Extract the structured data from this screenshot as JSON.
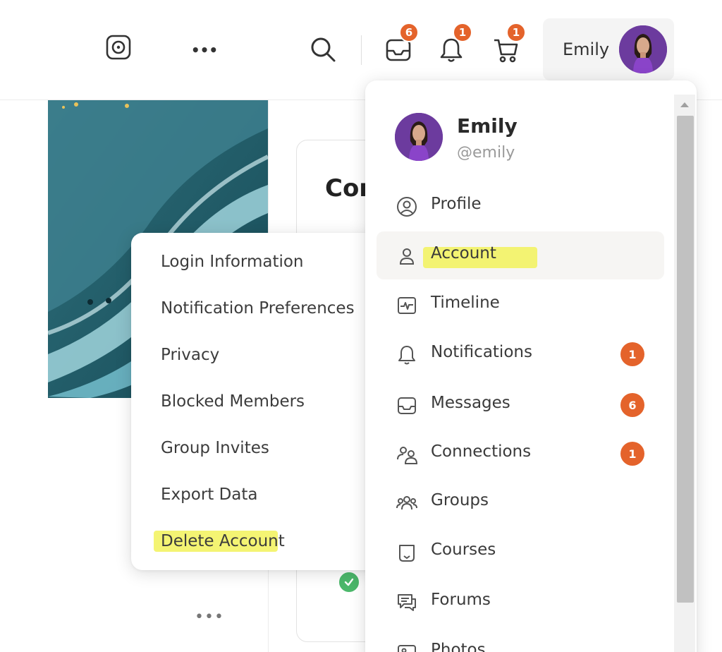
{
  "header": {
    "user_name": "Emily",
    "badges": {
      "messages": "6",
      "notifications": "1",
      "cart": "1"
    },
    "more_label": "•••",
    "icons": [
      "lens-icon",
      "more-icon",
      "search-icon",
      "inbox-icon",
      "bell-icon",
      "cart-icon",
      "avatar"
    ]
  },
  "content": {
    "card_title": "Cor",
    "more_label": "•••"
  },
  "submenu": {
    "items": [
      {
        "label": "Login Information"
      },
      {
        "label": "Notification Preferences"
      },
      {
        "label": "Privacy"
      },
      {
        "label": "Blocked Members"
      },
      {
        "label": "Group Invites"
      },
      {
        "label": "Export Data"
      },
      {
        "label": "Delete Account",
        "highlighted": true
      }
    ]
  },
  "dropdown": {
    "name": "Emily",
    "handle": "@emily",
    "items": [
      {
        "label": "Profile",
        "icon": "user-circle-icon"
      },
      {
        "label": "Account",
        "icon": "user-icon",
        "active": true,
        "highlighted": true
      },
      {
        "label": "Timeline",
        "icon": "activity-icon"
      },
      {
        "label": "Notifications",
        "icon": "bell-icon",
        "count": "1"
      },
      {
        "label": "Messages",
        "icon": "inbox-icon",
        "count": "6"
      },
      {
        "label": "Connections",
        "icon": "connections-icon",
        "count": "1"
      },
      {
        "label": "Groups",
        "icon": "groups-icon"
      },
      {
        "label": "Courses",
        "icon": "courses-icon"
      },
      {
        "label": "Forums",
        "icon": "forums-icon"
      },
      {
        "label": "Photos",
        "icon": "photos-icon"
      }
    ]
  },
  "colors": {
    "badge": "#e4632b",
    "highlight": "#f2f25a",
    "check": "#4cb86b",
    "avatar_bg": "#6c3b9e"
  }
}
